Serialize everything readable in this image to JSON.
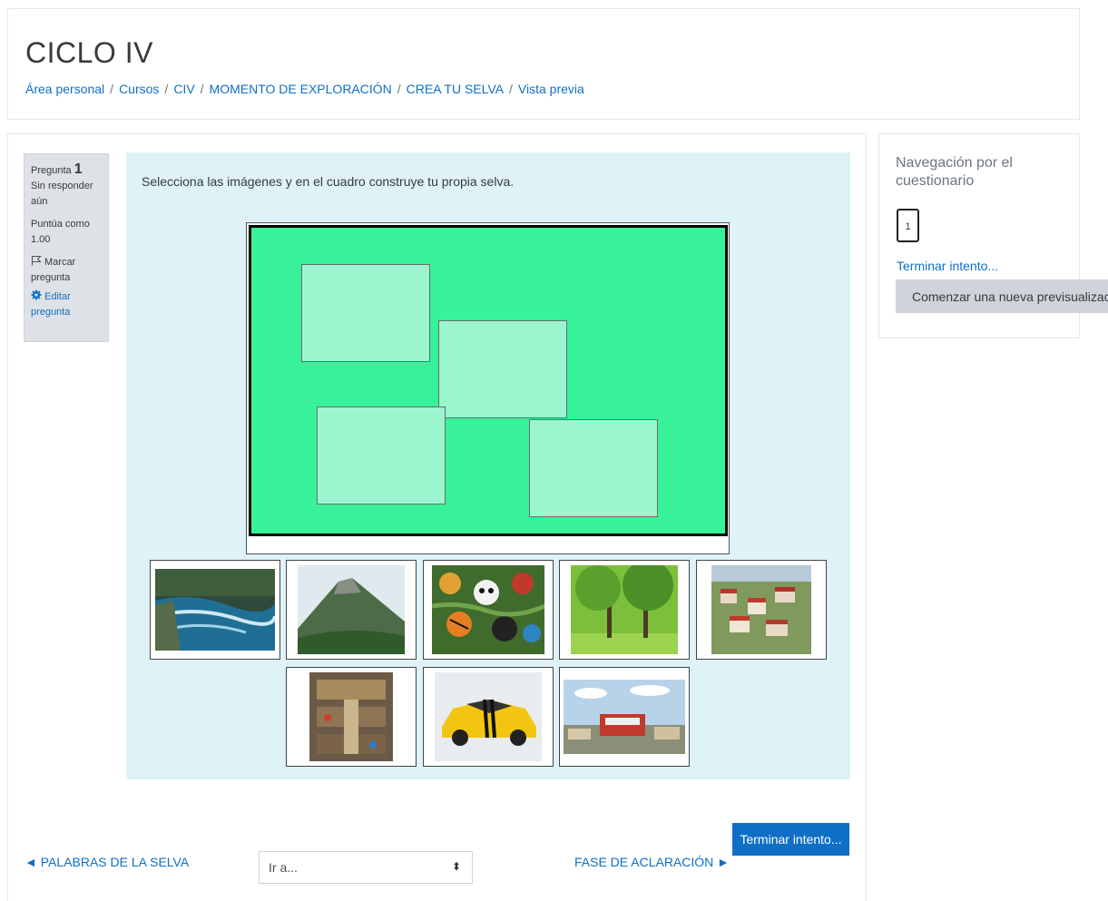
{
  "header": {
    "title": "CICLO IV",
    "breadcrumb": [
      "Área personal",
      "Cursos",
      "CIV",
      "MOMENTO DE EXPLORACIÓN",
      "CREA TU SELVA",
      "Vista previa"
    ],
    "separator": "/"
  },
  "question_info": {
    "label": "Pregunta",
    "number": "1",
    "status": "Sin responder aún",
    "score_label": "Puntúa como",
    "score_value": "1.00",
    "flag_label": "Marcar pregunta",
    "flag_icon": "flag-icon",
    "edit_label": "Editar pregunta",
    "edit_icon": "gear-icon"
  },
  "question": {
    "text": "Selecciona las imágenes y en el cuadro construye tu propia selva.",
    "canvas_color": "#38f29a",
    "drop_zone_color": "#9bf6cf",
    "drop_zone_count": 4,
    "drag_images": [
      "river",
      "volcano",
      "jungle-animals",
      "green-park",
      "hillside-town",
      "shopping-mall",
      "yellow-car",
      "city-building"
    ]
  },
  "quiz_nav": {
    "title": "Navegación por el cuestionario",
    "question_buttons": [
      "1"
    ],
    "finish_link": "Terminar intento...",
    "new_preview_button": "Comenzar una nueva previsualización"
  },
  "footer": {
    "finish_button": "Terminar intento...",
    "prev_link": "◄ PALABRAS DE LA SELVA",
    "next_link": "FASE DE ACLARACIÓN ►",
    "jump_placeholder": "Ir a...",
    "jump_arrows": "⬍"
  },
  "colors": {
    "link": "#0f6fc5",
    "primary_button": "#0f6fc5",
    "content_bg": "#def2f8",
    "info_bg": "#dee2e6"
  }
}
